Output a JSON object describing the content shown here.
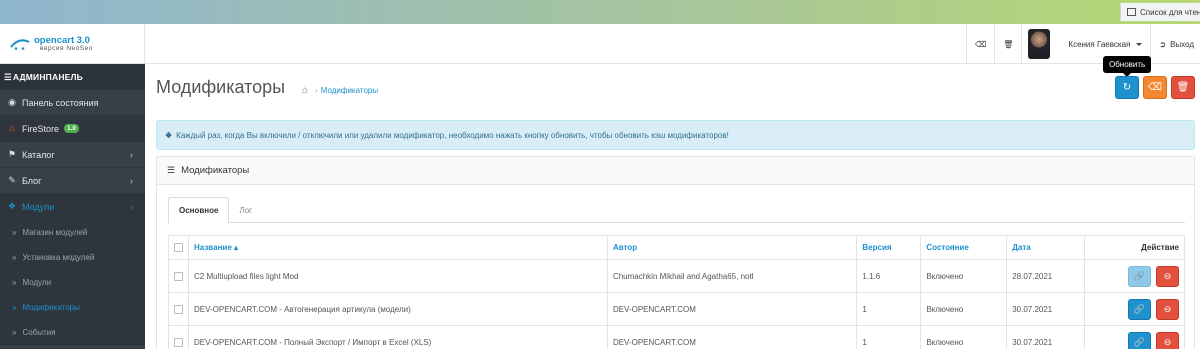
{
  "browser": {
    "reading_list_label": "Список для чтения"
  },
  "header": {
    "logo_title": "opencart 3.0",
    "logo_subtitle": "версия NeoSeo",
    "user_name": "Ксения Гаевская",
    "logout_label": "Выход",
    "icons": [
      "eraser-icon",
      "trash-icon"
    ]
  },
  "sidebar": {
    "title": "АДМИНПАНЕЛЬ",
    "items": [
      {
        "label": "Панель состояния",
        "icon": "dashboard-icon"
      },
      {
        "label": "FireStore",
        "badge": "1.0",
        "icon": "fire-icon"
      },
      {
        "label": "Каталог",
        "icon": "tag-icon"
      },
      {
        "label": "Блог",
        "icon": "pencil-icon"
      },
      {
        "label": "Модули",
        "icon": "puzzle-icon"
      }
    ],
    "subitems": [
      {
        "label": "Магазин модулей"
      },
      {
        "label": "Установка модулей"
      },
      {
        "label": "Модули"
      },
      {
        "label": "Модификаторы"
      },
      {
        "label": "События"
      }
    ]
  },
  "page": {
    "title": "Модификаторы",
    "breadcrumb": "Модификаторы",
    "tooltip": "Обновить",
    "alert": "Каждый раз, когда Вы включили / отключили или удалили модификатор, необходимо нажать кнопку обновить, чтобы обновить кэш модификаторов!",
    "panel_title": "Модификаторы",
    "tabs": [
      "Основное",
      "Лог"
    ]
  },
  "table": {
    "headers": {
      "name": "Название",
      "author": "Автор",
      "version": "Версия",
      "status": "Состояние",
      "date": "Дата",
      "action": "Действие"
    },
    "rows": [
      {
        "name": "C2 Multiupload files light Mod",
        "author": "Chumachkin Mikhail and Agatha65, notl",
        "version": "1.1.6",
        "status": "Включено",
        "date": "28.07.2021"
      },
      {
        "name": "DEV-OPENCART.COM - Автогенерация артикула (модели)",
        "author": "DEV-OPENCART.COM",
        "version": "1",
        "status": "Включено",
        "date": "30.07.2021"
      },
      {
        "name": "DEV-OPENCART.COM - Полный Экспорт / Импорт в Excel (XLS)",
        "author": "DEV-OPENCART.COM",
        "version": "1",
        "status": "Включено",
        "date": "30.07.2021"
      }
    ]
  },
  "colors": {
    "primary": "#1e91cf",
    "warning": "#f38733",
    "danger": "#e3503e",
    "sidebar": "#374049"
  }
}
